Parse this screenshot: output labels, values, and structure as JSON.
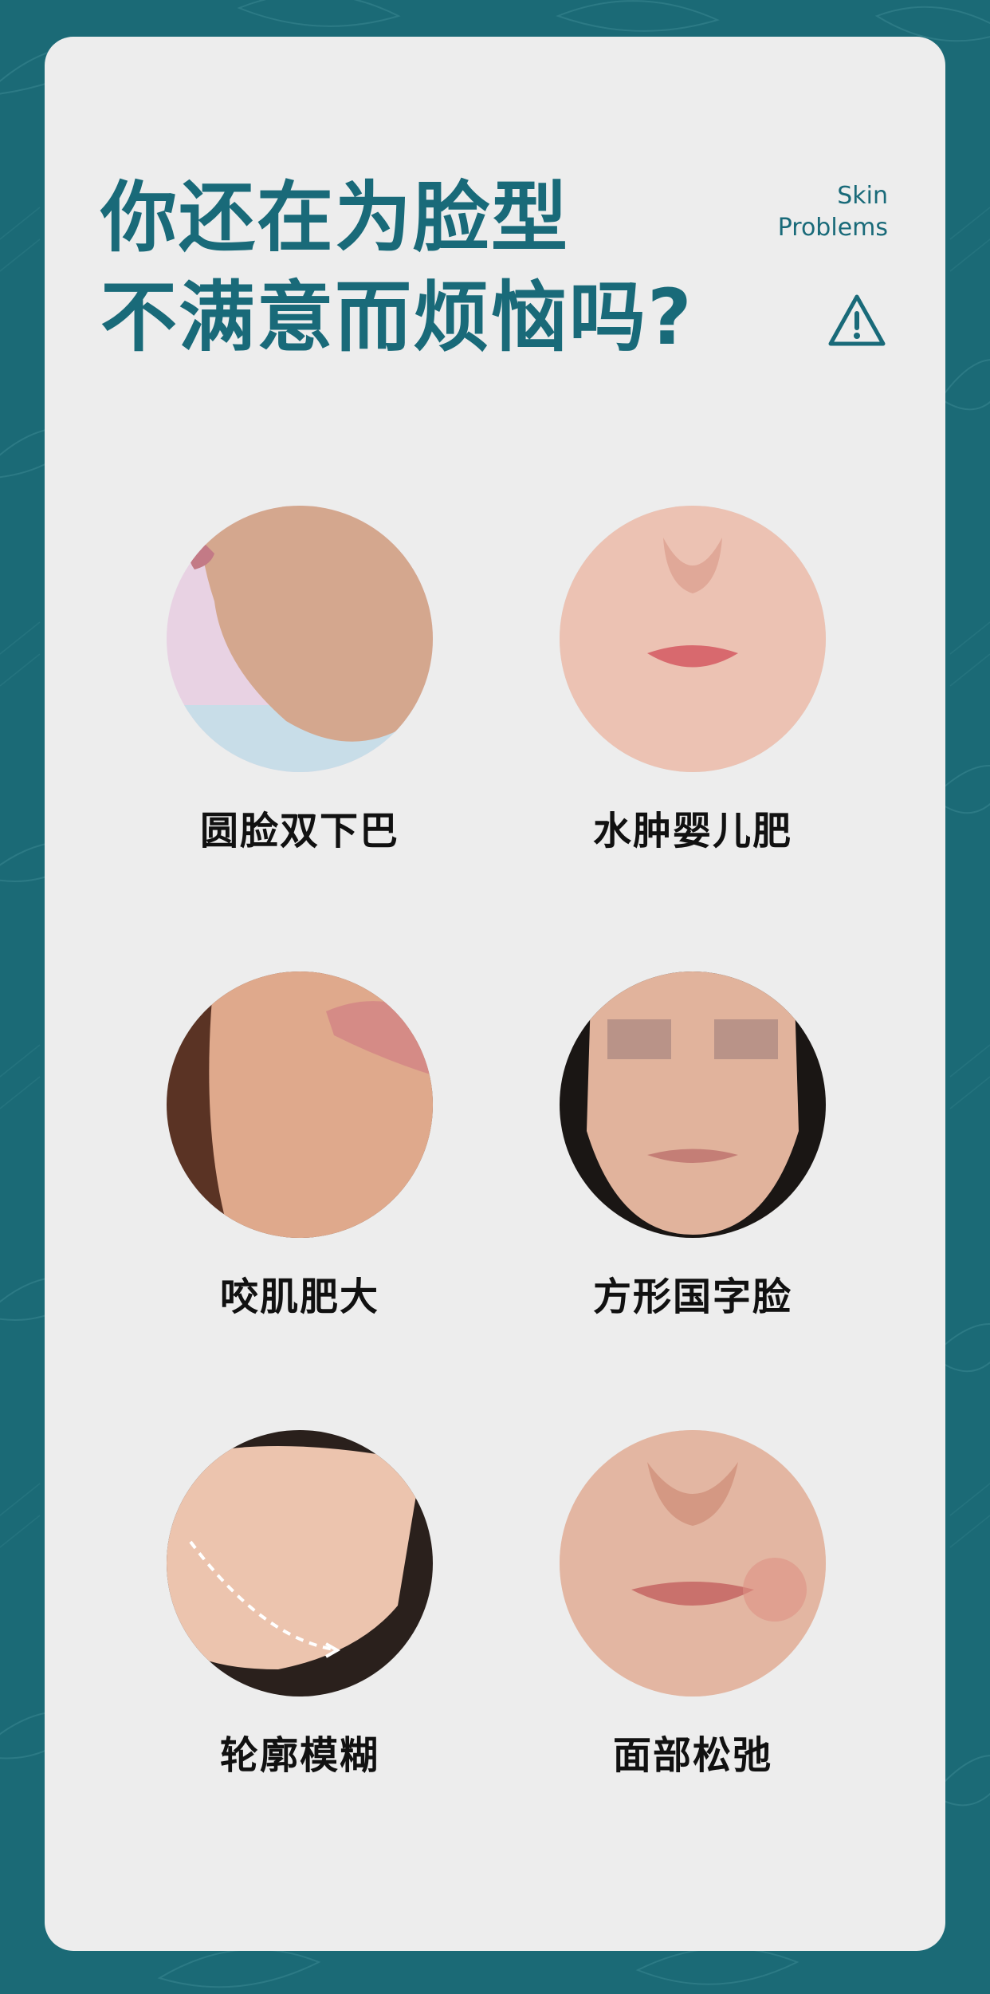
{
  "header": {
    "title_line1": "你还在为脸型",
    "title_line2": "不满意而烦恼吗?",
    "tag_line1": "Skin",
    "tag_line2": "Problems",
    "warning_icon": "warning-triangle-icon"
  },
  "problems": [
    {
      "label": "圆脸双下巴"
    },
    {
      "label": "水肿婴儿肥"
    },
    {
      "label": "咬肌肥大"
    },
    {
      "label": "方形国字脸"
    },
    {
      "label": "轮廓模糊"
    },
    {
      "label": "面部松弛"
    }
  ],
  "colors": {
    "background": "#1b6a76",
    "card": "#ededed",
    "accent": "#196a79",
    "label": "#111111"
  }
}
